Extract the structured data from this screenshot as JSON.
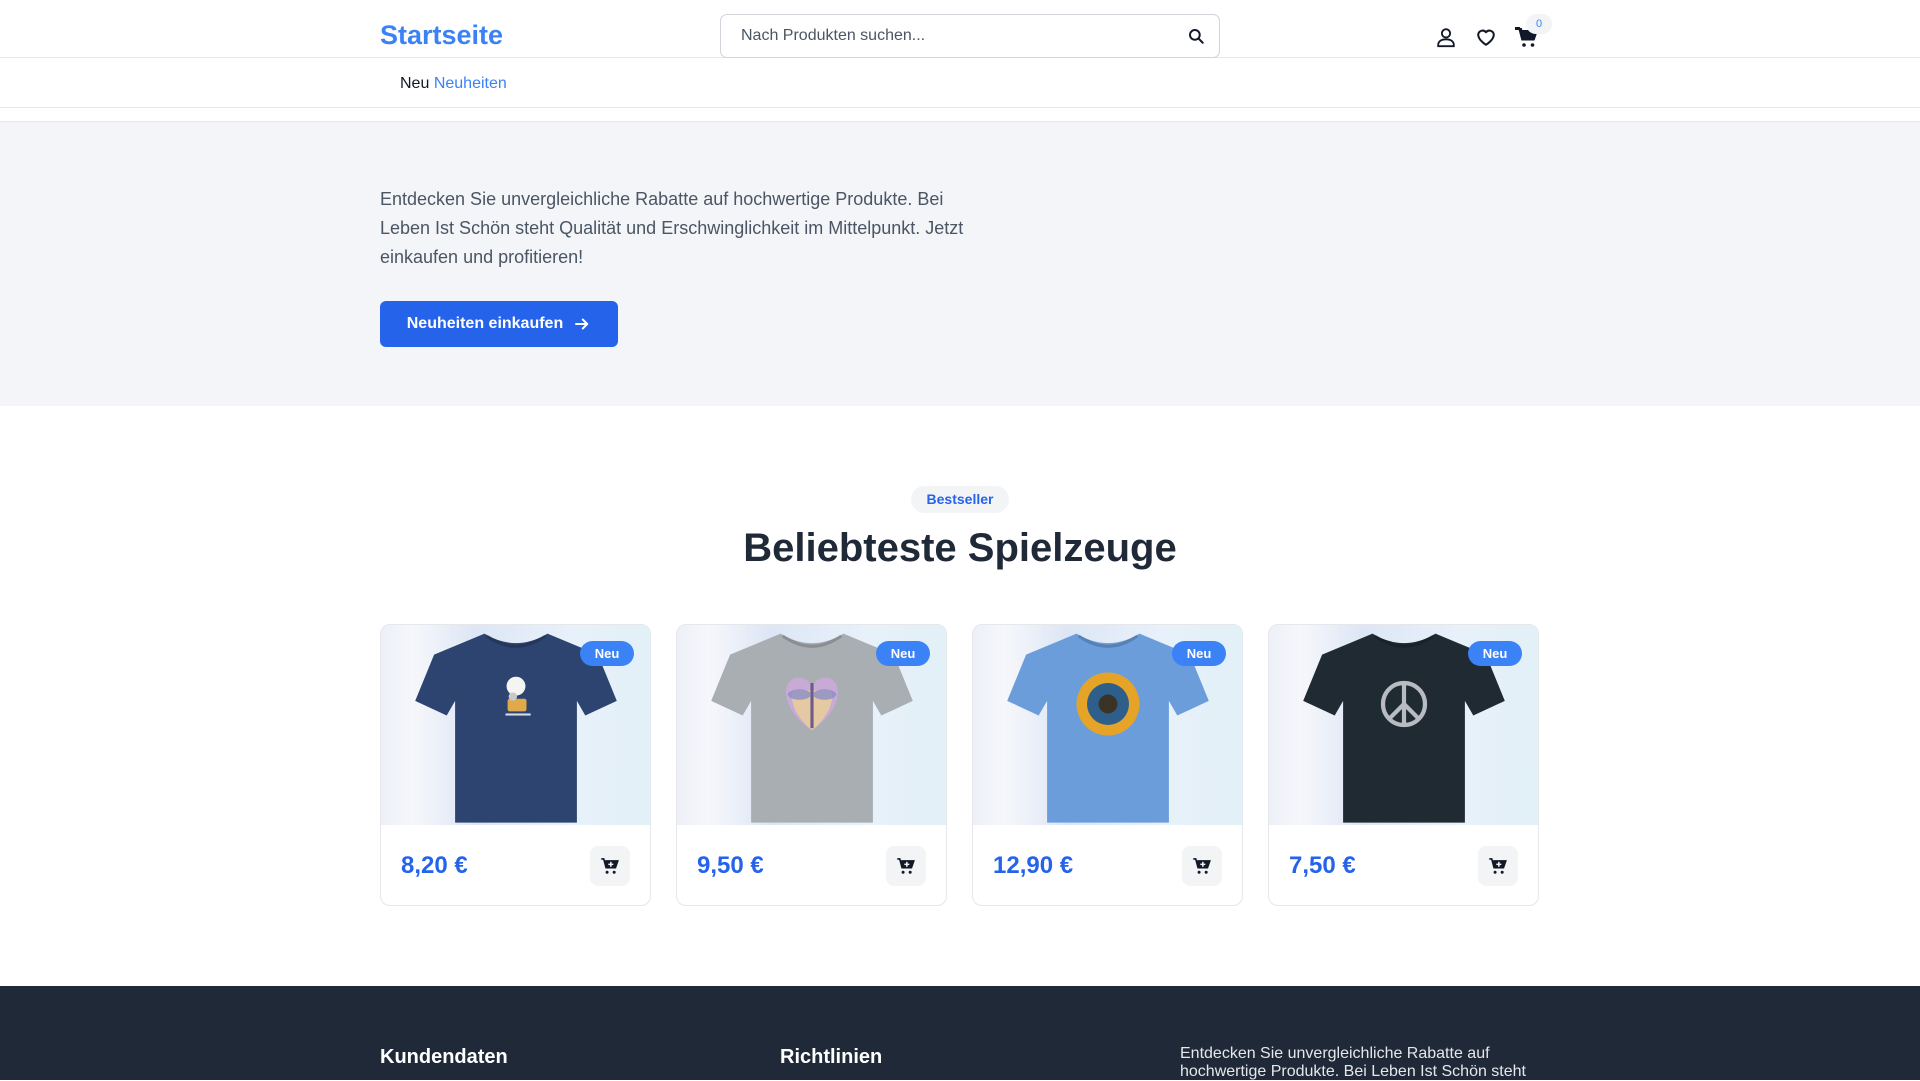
{
  "header": {
    "logo": "Startseite",
    "search_placeholder": "Nach Produkten suchen...",
    "cart_count": "0"
  },
  "nav": {
    "prefix": "Neu",
    "link": "Neuheiten"
  },
  "hero": {
    "text": "Entdecken Sie unvergleichliche Rabatte auf hochwertige Produkte. Bei Leben Ist Schön steht Qualität und Erschwinglichkeit im Mittelpunkt. Jetzt einkaufen und profitieren!",
    "button_label": "Neuheiten einkaufen"
  },
  "bestseller": {
    "badge": "Bestseller",
    "title": "Beliebteste Spielzeuge",
    "products": [
      {
        "badge": "Neu",
        "price": "8,20 €",
        "shirt_color": "#2d4470",
        "print": "moon-cat"
      },
      {
        "badge": "Neu",
        "price": "9,50 €",
        "shirt_color": "#a9aeb3",
        "print": "heart-dragonfly"
      },
      {
        "badge": "Neu",
        "price": "12,90 €",
        "shirt_color": "#6b9ddb",
        "print": "sunflower"
      },
      {
        "badge": "Neu",
        "price": "7,50 €",
        "shirt_color": "#1f2a33",
        "print": "peace"
      }
    ]
  },
  "footer": {
    "col1_title": "Kundendaten",
    "col2_title": "Richtlinien",
    "about_text": "Entdecken Sie unvergleichliche Rabatte auf hochwertige Produkte. Bei Leben Ist Schön steht"
  },
  "colors": {
    "accent": "#3b82f6",
    "button": "#2563eb",
    "footer_bg": "#1f2937"
  }
}
